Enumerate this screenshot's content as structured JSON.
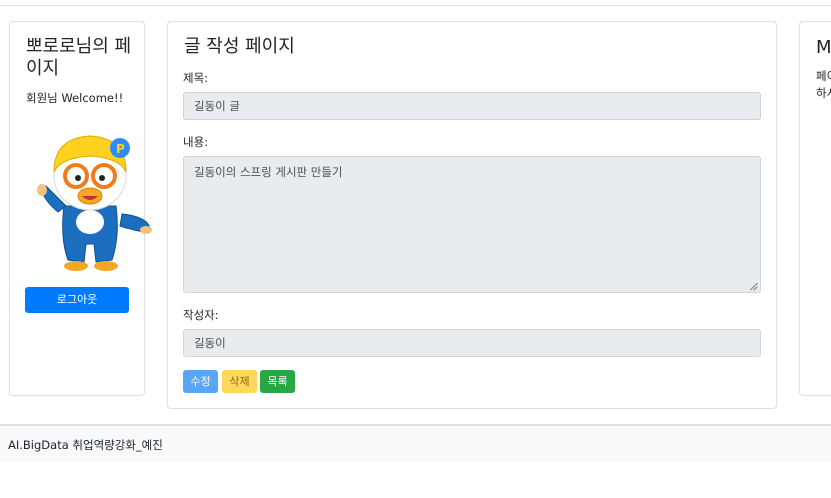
{
  "sidebar": {
    "title": "뽀로로님의 페이지",
    "welcome": "회원님 Welcome!!",
    "logout_label": "로그아웃"
  },
  "main": {
    "heading": "글 작성 페이지",
    "title_label": "제목:",
    "title_value": "길동이 글",
    "content_label": "내용:",
    "content_value": "길동이의 스프링 게시판 만들기",
    "writer_label": "작성자:",
    "writer_value": "길동이",
    "buttons": {
      "edit": "수정",
      "delete": "삭제",
      "list": "목록"
    }
  },
  "right_panel": {
    "title": "M",
    "text_line1": "페이",
    "text_line2": "하시"
  },
  "footer": {
    "text": "AI.BigData 취업역량강화_예진"
  },
  "colors": {
    "primary": "#007bff",
    "edit": "#5ba5f5",
    "delete": "#ffd75a",
    "list": "#28a745",
    "readonly_field": "#e9ecef"
  }
}
